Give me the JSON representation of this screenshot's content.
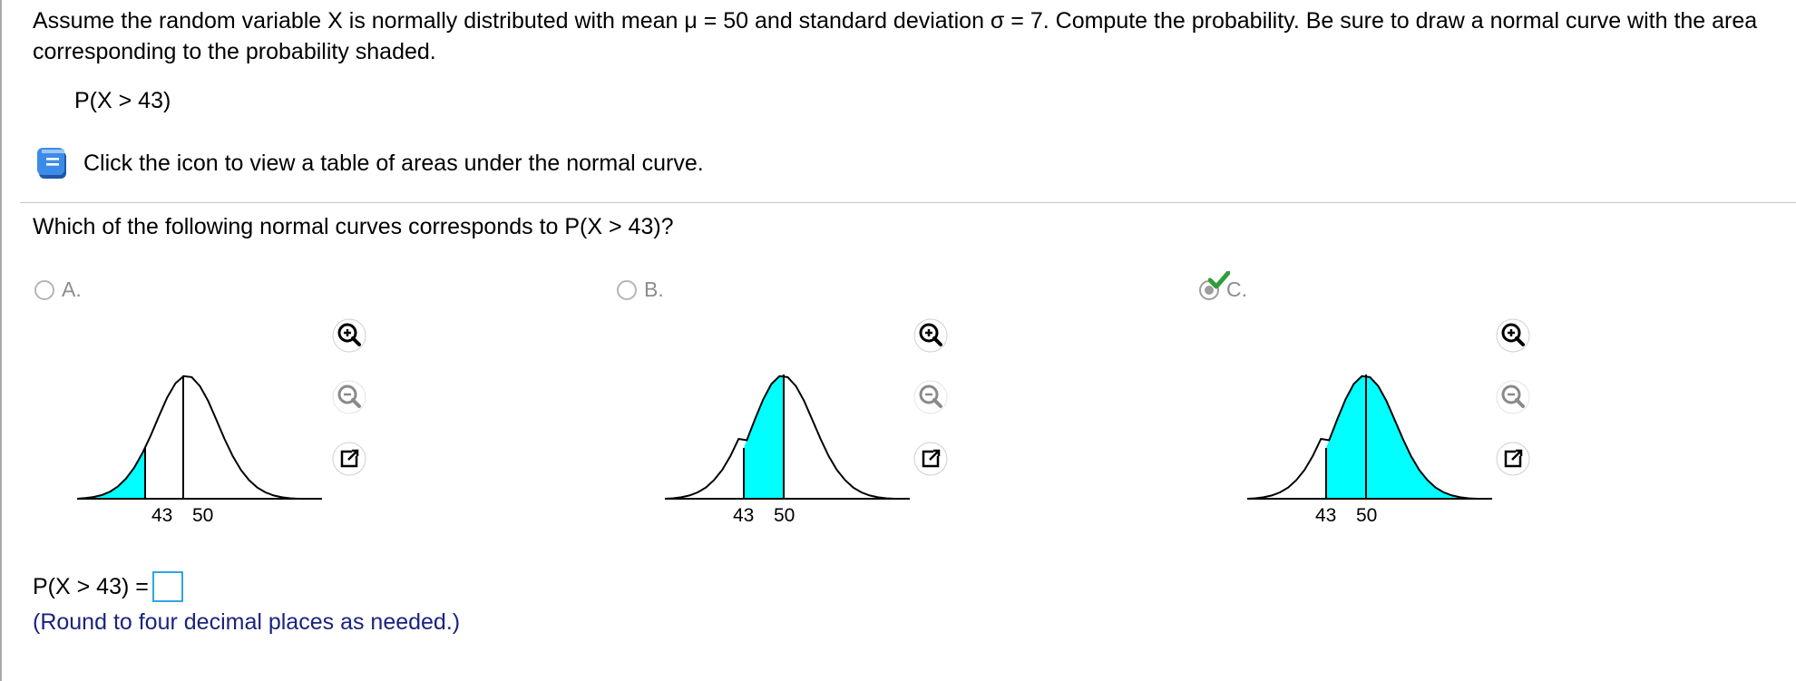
{
  "question": {
    "text": "Assume the random variable X is normally distributed with mean μ = 50 and standard deviation σ = 7. Compute the probability. Be sure to draw a normal curve with the area corresponding to the probability shaded.",
    "target": "P(X > 43)"
  },
  "table_link": {
    "icon": "book-icon",
    "text": "Click the icon to view a table of areas under the normal curve."
  },
  "sub_question": "Which of the following normal curves corresponds to P(X > 43)?",
  "options": [
    {
      "letter": "A.",
      "selected": false,
      "shading": "left of 43",
      "tick_left": "43",
      "tick_right": "50"
    },
    {
      "letter": "B.",
      "selected": false,
      "shading": "between 43 and 50",
      "tick_left": "43",
      "tick_right": "50"
    },
    {
      "letter": "C.",
      "selected": true,
      "correct": true,
      "shading": "right of 43",
      "tick_left": "43",
      "tick_right": "50"
    }
  ],
  "tools": [
    "zoom-in-icon",
    "zoom-out-icon",
    "expand-icon"
  ],
  "answer": {
    "label": "P(X > 43) =",
    "value": "",
    "hint": "(Round to four decimal places as needed.)"
  },
  "colors": {
    "shade": "#00ffff",
    "check": "#2e9e3c",
    "hint_text": "#1a237e",
    "answer_box_border": "#2fa4e7"
  }
}
